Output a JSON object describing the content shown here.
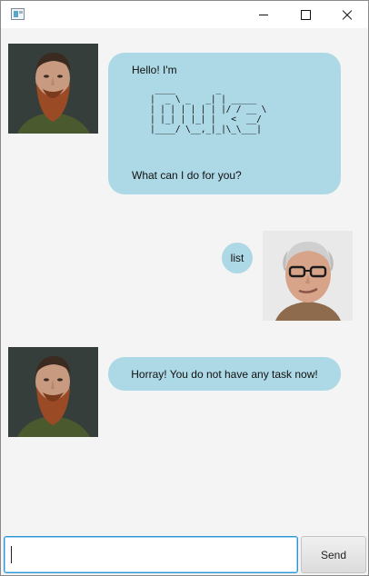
{
  "window": {
    "controls": {
      "minimize": "minimize",
      "maximize": "maximize",
      "close": "close"
    }
  },
  "messages": [
    {
      "sender": "bot",
      "avatar": "bearded-man-avatar",
      "greeting": "Hello! I'm",
      "ascii_logo": " ____        _\n|  _ \\ _   _| | _____\n| | | | | | | |/ / __ \\\n| |_| | |_| |   <  __/\n|____/ \\__,_|_|\\_\\___|",
      "question": "What can I do for you?"
    },
    {
      "sender": "user",
      "avatar": "glasses-man-avatar",
      "text": "list"
    },
    {
      "sender": "bot",
      "avatar": "bearded-man-avatar",
      "text": "Horray! You do not have any task now!"
    }
  ],
  "input": {
    "value": "",
    "placeholder": ""
  },
  "send_button": {
    "label": "Send"
  },
  "colors": {
    "bubble": "#add8e6",
    "background": "#f4f4f4",
    "input_focus": "#2d95d3"
  }
}
